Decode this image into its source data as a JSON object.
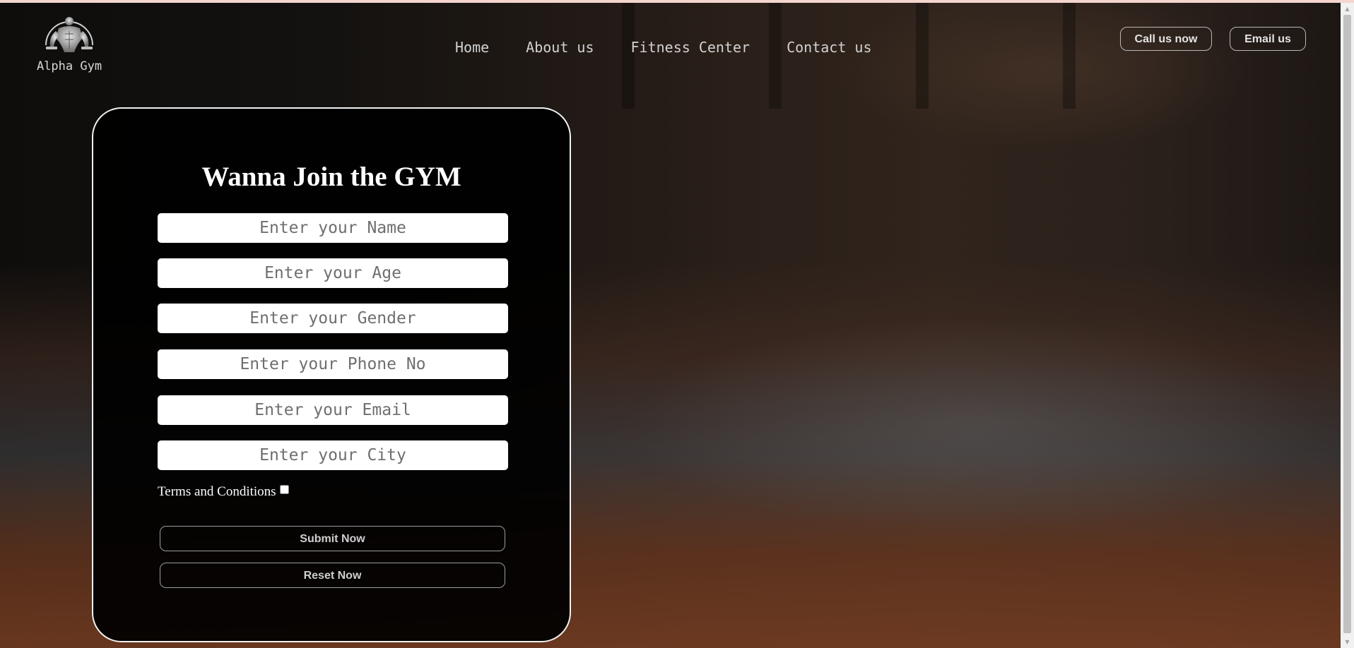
{
  "brand": {
    "name": "Alpha Gym",
    "logo_icon": "muscle-man-icon"
  },
  "nav": {
    "items": [
      {
        "label": "Home"
      },
      {
        "label": "About us"
      },
      {
        "label": "Fitness Center"
      },
      {
        "label": "Contact us"
      }
    ]
  },
  "header_actions": {
    "call_label": "Call us now",
    "email_label": "Email us"
  },
  "form": {
    "title": "Wanna Join the GYM",
    "fields": {
      "name_placeholder": "Enter your Name",
      "age_placeholder": "Enter your Age",
      "gender_placeholder": "Enter your Gender",
      "phone_placeholder": "Enter your Phone No",
      "email_placeholder": "Enter your Email",
      "city_placeholder": "Enter your City"
    },
    "terms_label": "Terms and Conditions",
    "submit_label": "Submit Now",
    "reset_label": "Reset Now"
  },
  "colors": {
    "page_background": "#0e0d0c",
    "top_strip": "#f4d6cf",
    "card_border": "#f0f0f0",
    "text_primary": "#ffffff",
    "nav_text": "#d2d2d2"
  }
}
